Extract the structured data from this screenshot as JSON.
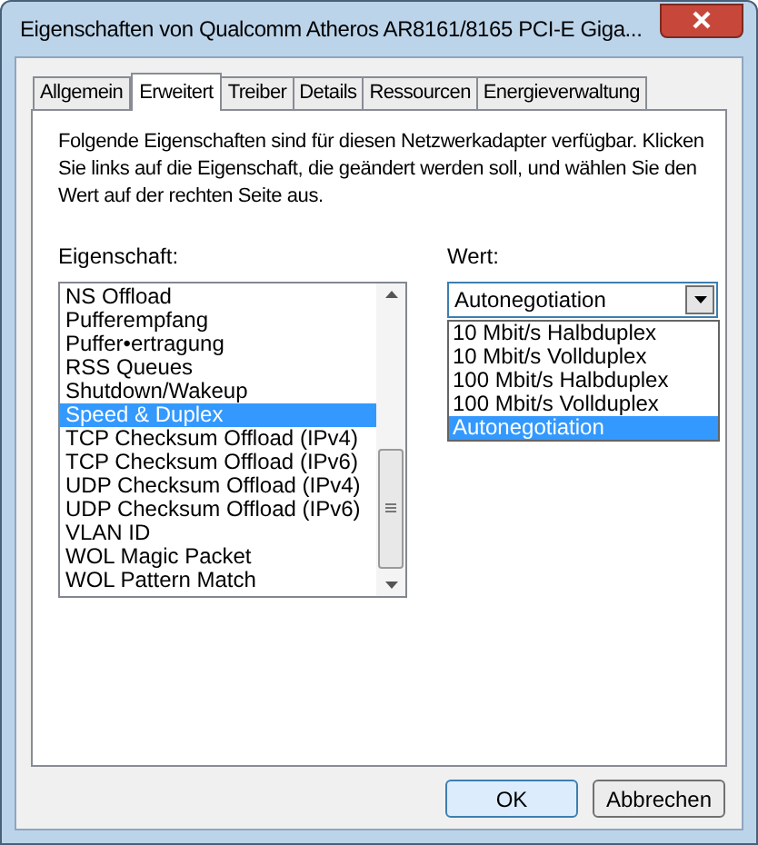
{
  "window": {
    "title": "Eigenschaften von Qualcomm Atheros AR8161/8165 PCI-E Giga..."
  },
  "tabs": [
    {
      "label": "Allgemein",
      "selected": false
    },
    {
      "label": "Erweitert",
      "selected": true
    },
    {
      "label": "Treiber",
      "selected": false
    },
    {
      "label": "Details",
      "selected": false
    },
    {
      "label": "Ressourcen",
      "selected": false
    },
    {
      "label": "Energieverwaltung",
      "selected": false
    }
  ],
  "description": "Folgende Eigenschaften sind für diesen Netzwerkadapter verfügbar. Klicken Sie links auf die Eigenschaft, die geändert werden soll, und wählen Sie den Wert auf der rechten Seite aus.",
  "property_label": "Eigenschaft:",
  "properties": [
    {
      "label": "NS Offload",
      "selected": false
    },
    {
      "label": "Pufferempfang",
      "selected": false
    },
    {
      "label": "Puffer•ertragung",
      "selected": false
    },
    {
      "label": "RSS Queues",
      "selected": false
    },
    {
      "label": "Shutdown/Wakeup",
      "selected": false
    },
    {
      "label": "Speed & Duplex",
      "selected": true
    },
    {
      "label": "TCP Checksum Offload (IPv4)",
      "selected": false
    },
    {
      "label": "TCP Checksum Offload (IPv6)",
      "selected": false
    },
    {
      "label": "UDP Checksum Offload (IPv4)",
      "selected": false
    },
    {
      "label": "UDP Checksum Offload (IPv6)",
      "selected": false
    },
    {
      "label": "VLAN ID",
      "selected": false
    },
    {
      "label": "WOL Magic Packet",
      "selected": false
    },
    {
      "label": "WOL Pattern Match",
      "selected": false
    }
  ],
  "value_label": "Wert:",
  "value_dropdown": {
    "value": "Autonegotiation",
    "expanded": true
  },
  "value_options": [
    {
      "label": "10 Mbit/s Halbduplex",
      "selected": false
    },
    {
      "label": "10 Mbit/s Vollduplex",
      "selected": false
    },
    {
      "label": "100 Mbit/s Halbduplex",
      "selected": false
    },
    {
      "label": "100 Mbit/s Vollduplex",
      "selected": false
    },
    {
      "label": "Autonegotiation",
      "selected": true
    }
  ],
  "buttons": [
    {
      "label": "OK",
      "kind": "default"
    },
    {
      "label": "Abbrechen",
      "kind": "normal"
    }
  ]
}
